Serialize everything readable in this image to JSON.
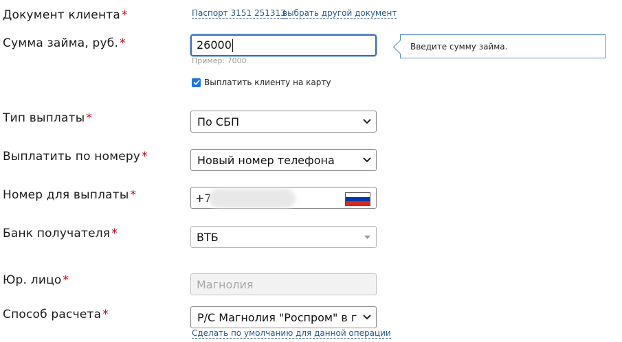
{
  "document": {
    "label": "Документ клиента",
    "passport_link": "Паспорт 3151 251313",
    "choose_other_link": "выбрать другой документ"
  },
  "loan_amount": {
    "label": "Сумма займа, руб.",
    "value": "26000",
    "hint": "Пример: 7000",
    "tooltip": "Введите сумму займа."
  },
  "pay_to_card": {
    "label": "Выплатить клиенту на карту",
    "checked": true
  },
  "payout_type": {
    "label": "Тип выплаты",
    "selected": "По СБП"
  },
  "payout_by_number": {
    "label": "Выплатить по номеру",
    "selected": "Новый номер телефона"
  },
  "payout_number": {
    "label": "Номер для выплаты",
    "prefix": "+7"
  },
  "recipient_bank": {
    "label": "Банк получателя",
    "selected": "ВТБ"
  },
  "legal_entity": {
    "label": "Юр. лицо",
    "value": "Магнолия"
  },
  "settlement_method": {
    "label": "Способ расчета",
    "selected": "Р/С Магнолия \"Роспром\" в г.",
    "default_link": "Сделать по умолчанию для данной операции"
  },
  "required_mark": "*",
  "colors": {
    "required": "#d0021b",
    "link": "#2a5a8c",
    "focus_border": "#3b72b7",
    "checkbox": "#1a73e8"
  },
  "icons": {
    "flag": "russia-flag-icon",
    "select_arrow": "chevron-down-icon",
    "combo_arrow": "triangle-down-icon",
    "checkbox": "check-icon"
  }
}
